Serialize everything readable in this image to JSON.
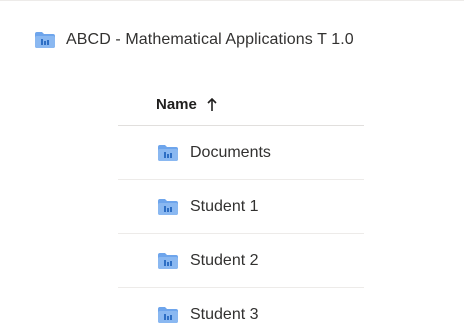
{
  "breadcrumb": {
    "icon": "folder-icon",
    "label": "ABCD - Mathematical Applications T 1.0"
  },
  "list": {
    "header": {
      "label": "Name",
      "sort_icon": "arrow-up-icon",
      "sort_direction": "ascending"
    },
    "items": [
      {
        "label": "Documents",
        "icon": "folder-icon"
      },
      {
        "label": "Student 1",
        "icon": "folder-icon"
      },
      {
        "label": "Student 2",
        "icon": "folder-icon"
      },
      {
        "label": "Student 3",
        "icon": "folder-icon"
      }
    ]
  },
  "colors": {
    "folder_body": "#8ab8f1",
    "folder_tab": "#6ea5ec",
    "folder_badge": "#2d6ec4",
    "text": "#323130",
    "divider": "#edebe9"
  }
}
